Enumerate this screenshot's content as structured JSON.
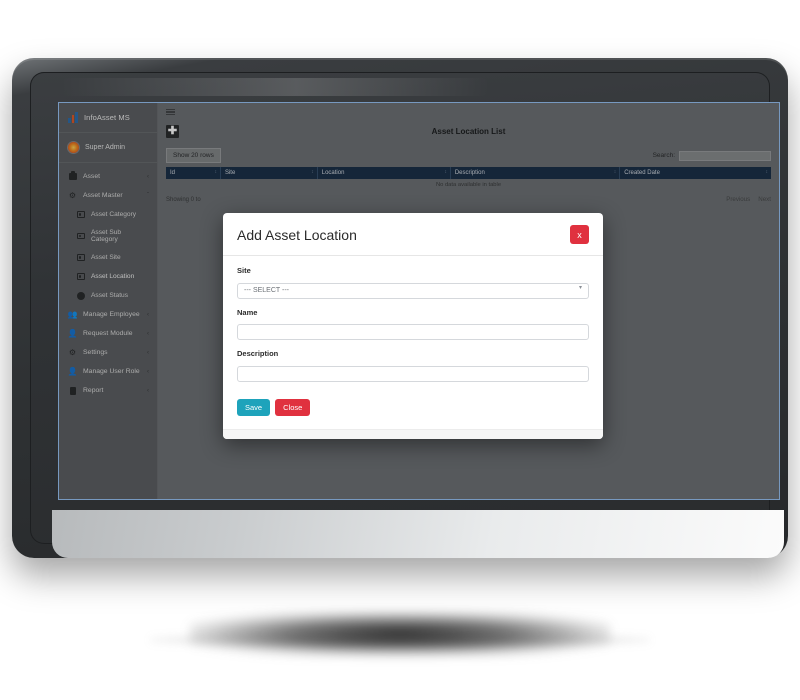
{
  "app": {
    "brand": "InfoAsset MS",
    "user": "Super Admin"
  },
  "sidebar": {
    "items": [
      {
        "label": "Asset",
        "icon": "briefcase-icon",
        "caret": "‹",
        "child": false
      },
      {
        "label": "Asset Master",
        "icon": "gear-icon",
        "caret": "ˇ",
        "child": false
      },
      {
        "label": "Asset Category",
        "icon": "image-icon",
        "caret": "",
        "child": true
      },
      {
        "label": "Asset Sub Category",
        "icon": "image-icon",
        "caret": "",
        "child": true
      },
      {
        "label": "Asset Site",
        "icon": "image-icon",
        "caret": "",
        "child": true
      },
      {
        "label": "Asset Location",
        "icon": "image-icon",
        "caret": "",
        "child": true
      },
      {
        "label": "Asset Status",
        "icon": "clock-icon",
        "caret": "",
        "child": true
      },
      {
        "label": "Manage Employee",
        "icon": "people-icon",
        "caret": "‹",
        "child": false
      },
      {
        "label": "Request Module",
        "icon": "person-add-icon",
        "caret": "‹",
        "child": false
      },
      {
        "label": "Settings",
        "icon": "tools-icon",
        "caret": "‹",
        "child": false
      },
      {
        "label": "Manage User Role",
        "icon": "person-gear-icon",
        "caret": "‹",
        "child": false
      },
      {
        "label": "Report",
        "icon": "document-icon",
        "caret": "‹",
        "child": false
      }
    ]
  },
  "main": {
    "page_title": "Asset Location List",
    "add_button": "✚",
    "show_rows": "Show 20 rows",
    "search_label": "Search:",
    "search_value": "",
    "table": {
      "columns": [
        "Id",
        "Site",
        "Location",
        "Description",
        "Created Date"
      ],
      "rows": [],
      "empty_text": "No data available in table"
    },
    "showing_text": "Showing 0 to",
    "pagination": {
      "previous": "Previous",
      "next": "Next"
    }
  },
  "modal": {
    "title": "Add Asset Location",
    "close_x": "x",
    "fields": {
      "site_label": "Site",
      "site_value": "--- SELECT ---",
      "name_label": "Name",
      "name_value": "",
      "description_label": "Description",
      "description_value": ""
    },
    "save_label": "Save",
    "close_label": "Close"
  },
  "colors": {
    "save": "#1ea3bb",
    "danger": "#e0313f",
    "table_header": "#1c3149",
    "sidebar": "#5e6164"
  }
}
